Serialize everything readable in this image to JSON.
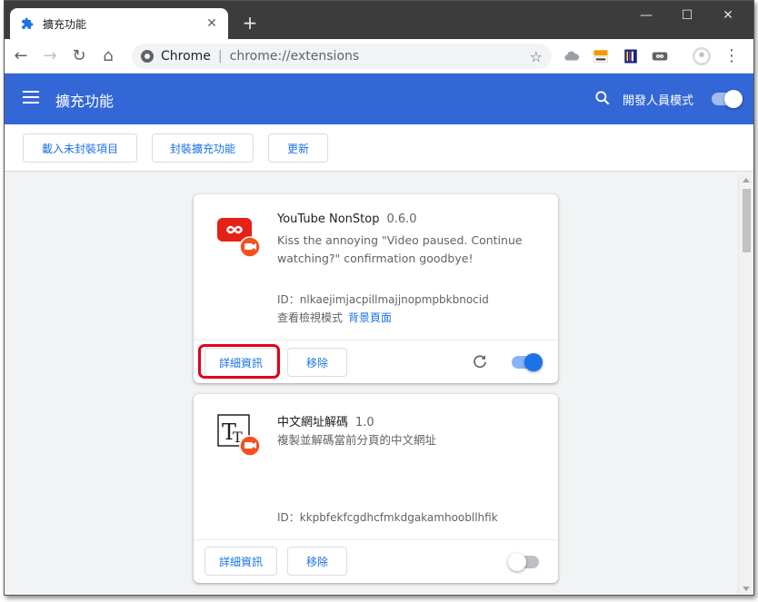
{
  "browser": {
    "tab_title": "擴充功能",
    "tab_close": "✕",
    "new_tab": "+",
    "window_controls": {
      "minimize": "—",
      "maximize": "☐",
      "close": "✕"
    },
    "url_host": "Chrome",
    "url_separator": "|",
    "url_path": "chrome://extensions",
    "nav": {
      "back": "←",
      "forward": "→",
      "reload": "↻",
      "home": "⌂"
    },
    "star": "☆",
    "menu": "⋮",
    "toolbar_icons": [
      "cloud-icon",
      "zhiwei-extension-icon",
      "barcode-extension-icon",
      "infinity-extension-icon",
      "profile-avatar-icon",
      "more-vert-icon"
    ]
  },
  "header": {
    "title": "擴充功能",
    "dev_mode_label": "開發人員模式",
    "dev_mode_on": true
  },
  "actions": {
    "load_unpacked": "載入未封裝項目",
    "pack_extension": "封裝擴充功能",
    "update": "更新"
  },
  "extensions": [
    {
      "name": "YouTube NonStop",
      "version": "0.6.0",
      "description": "Kiss the annoying \"Video paused. Continue watching?\" confirmation goodbye!",
      "id_text": "ID：nlkaejimjacpillmajjnopmpbkbnocid",
      "inspect_label": "查看檢視模式",
      "inspect_link": "背景頁面",
      "details_label": "詳細資訊",
      "remove_label": "移除",
      "enabled": true,
      "icon": "youtube-nonstop-icon"
    },
    {
      "name": "中文網址解碼",
      "version": "1.0",
      "description": "複製並解碼當前分頁的中文網址",
      "id_text": "ID：kkpbfekfcgdhcfmkdgakamhoobllhfik",
      "details_label": "詳細資訊",
      "remove_label": "移除",
      "enabled": false,
      "icon": "chinese-url-decode-icon"
    }
  ],
  "colors": {
    "header_blue": "#3367d6",
    "link_blue": "#1a73e8",
    "highlight_red": "#e0001a",
    "youtube_red": "#e62117",
    "badge_orange": "#f4511e"
  }
}
